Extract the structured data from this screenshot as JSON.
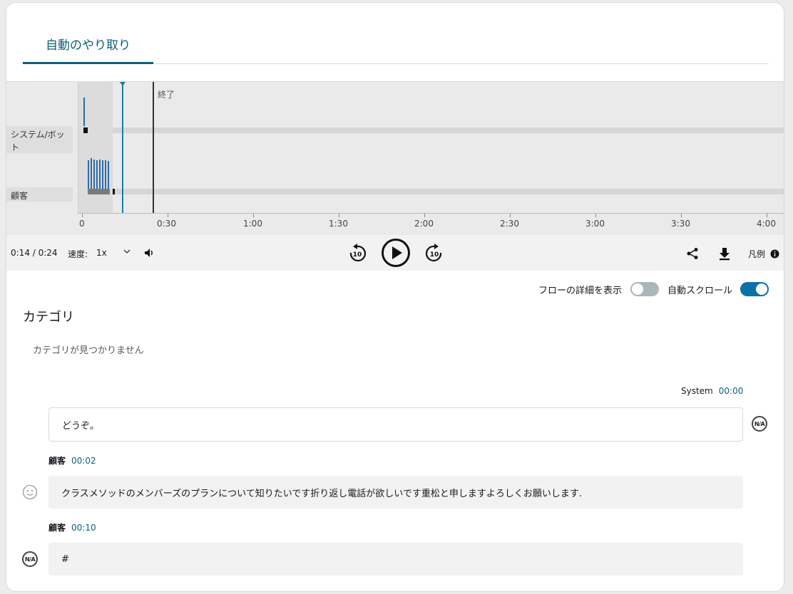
{
  "tabs": [
    {
      "label": "自動のやり取り",
      "active": true
    }
  ],
  "timeline": {
    "lanes": [
      {
        "label": "システム/ボット"
      },
      {
        "label": "顧客"
      }
    ],
    "end_marker_label": "終了",
    "axis_ticks": [
      "0",
      "0:30",
      "1:00",
      "1:30",
      "2:00",
      "2:30",
      "3:00",
      "3:30",
      "4:00"
    ],
    "position": "0:14",
    "end": "0:24"
  },
  "player": {
    "time_display": "0:14 / 0:24",
    "speed_label": "速度:",
    "speed_value": "1x",
    "legend_label": "凡例"
  },
  "toggles": {
    "flow_details": {
      "label": "フローの詳細を表示",
      "on": false
    },
    "auto_scroll": {
      "label": "自動スクロール",
      "on": true
    }
  },
  "categories": {
    "title": "カテゴリ",
    "empty_text": "カテゴリが見つかりません"
  },
  "transcript": [
    {
      "speaker": "System",
      "time": "00:00",
      "text": "どうぞ。",
      "sentiment": "N/A",
      "side": "system"
    },
    {
      "speaker": "顧客",
      "time": "00:02",
      "text": "クラスメソッドのメンバーズのプランについて知りたいです折り返し電話が欲しいです重松と申しますよろしくお願いします.",
      "sentiment": "neutral",
      "side": "customer"
    },
    {
      "speaker": "顧客",
      "time": "00:10",
      "text": "#",
      "sentiment": "N/A",
      "side": "customer"
    }
  ],
  "colors": {
    "accent": "#0b5f7a",
    "bar": "#2c6aa9",
    "toggle_on": "#0972a6",
    "toggle_off": "#aab7b8"
  }
}
